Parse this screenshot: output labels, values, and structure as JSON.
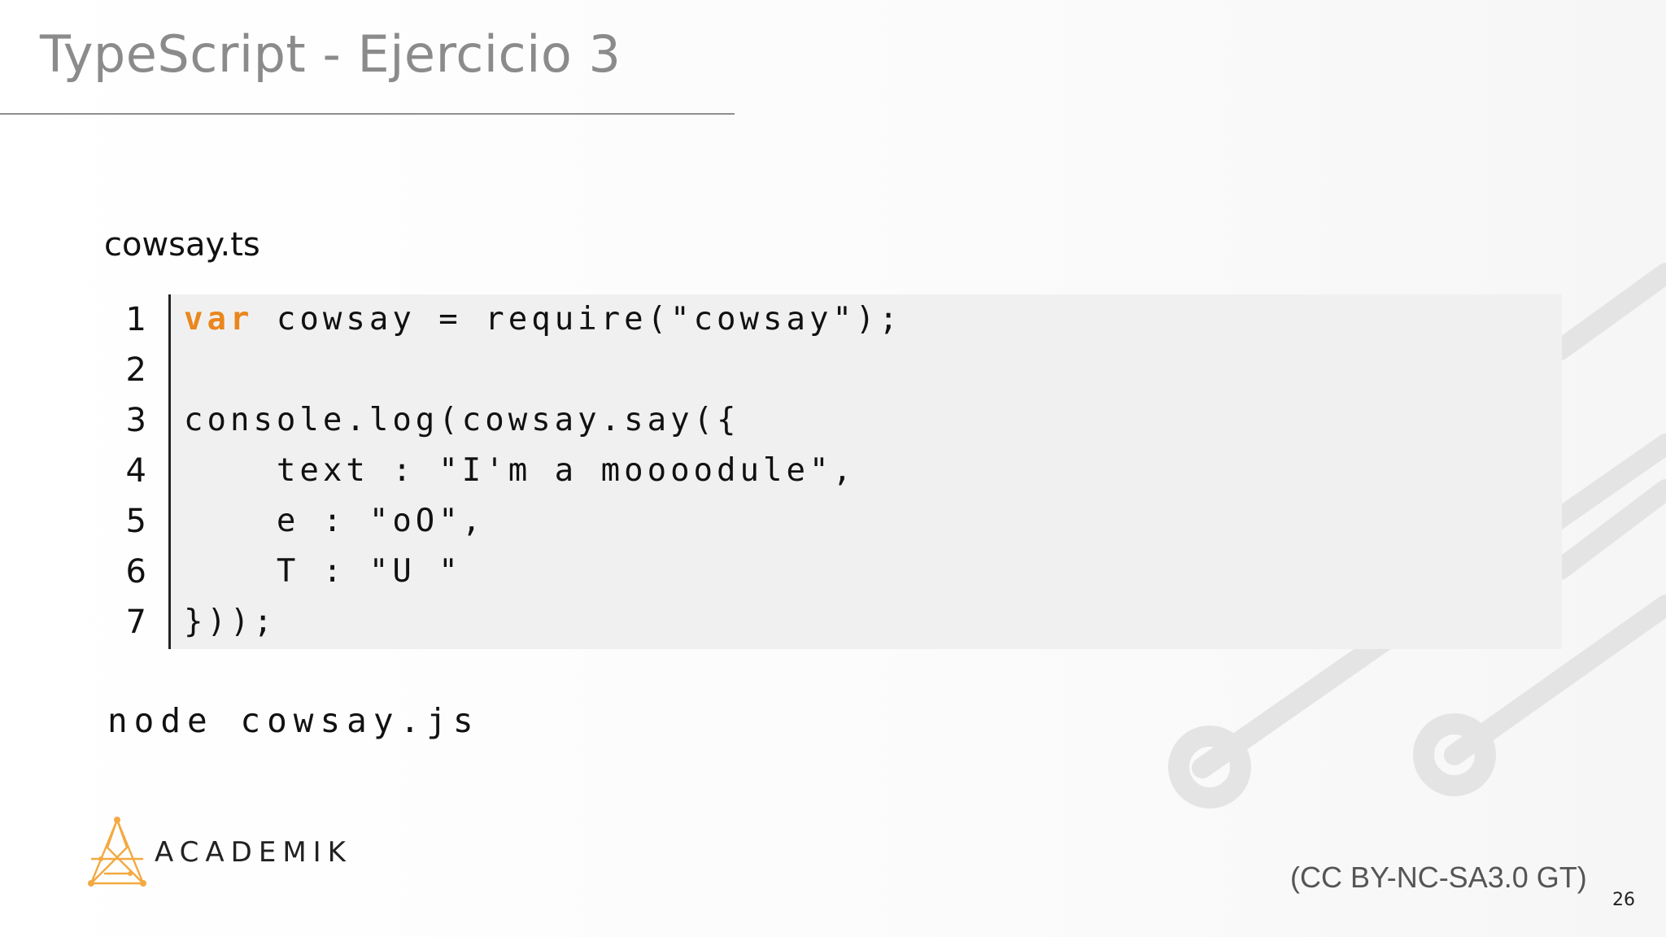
{
  "slide": {
    "title": "TypeScript - Ejercicio 3",
    "file_label": "cowsay.ts",
    "command": "node cowsay.js",
    "license": "(CC BY-NC-SA3.0 GT)",
    "page_number": "26",
    "accent_color": "#e9861d"
  },
  "brand": {
    "name": "ACADEMIK",
    "icon": "academik-logo-icon"
  },
  "code": {
    "line_numbers": [
      "1",
      "2",
      "3",
      "4",
      "5",
      "6",
      "7"
    ],
    "keyword": "var",
    "line1_rest": " cowsay = require(\"cowsay\");",
    "line2": "",
    "line3": "console.log(cowsay.say({",
    "line4": "    text : \"I'm a moooodule\",",
    "line5": "    e : \"oO\",",
    "line6": "    T : \"U \"",
    "line7": "}));"
  }
}
